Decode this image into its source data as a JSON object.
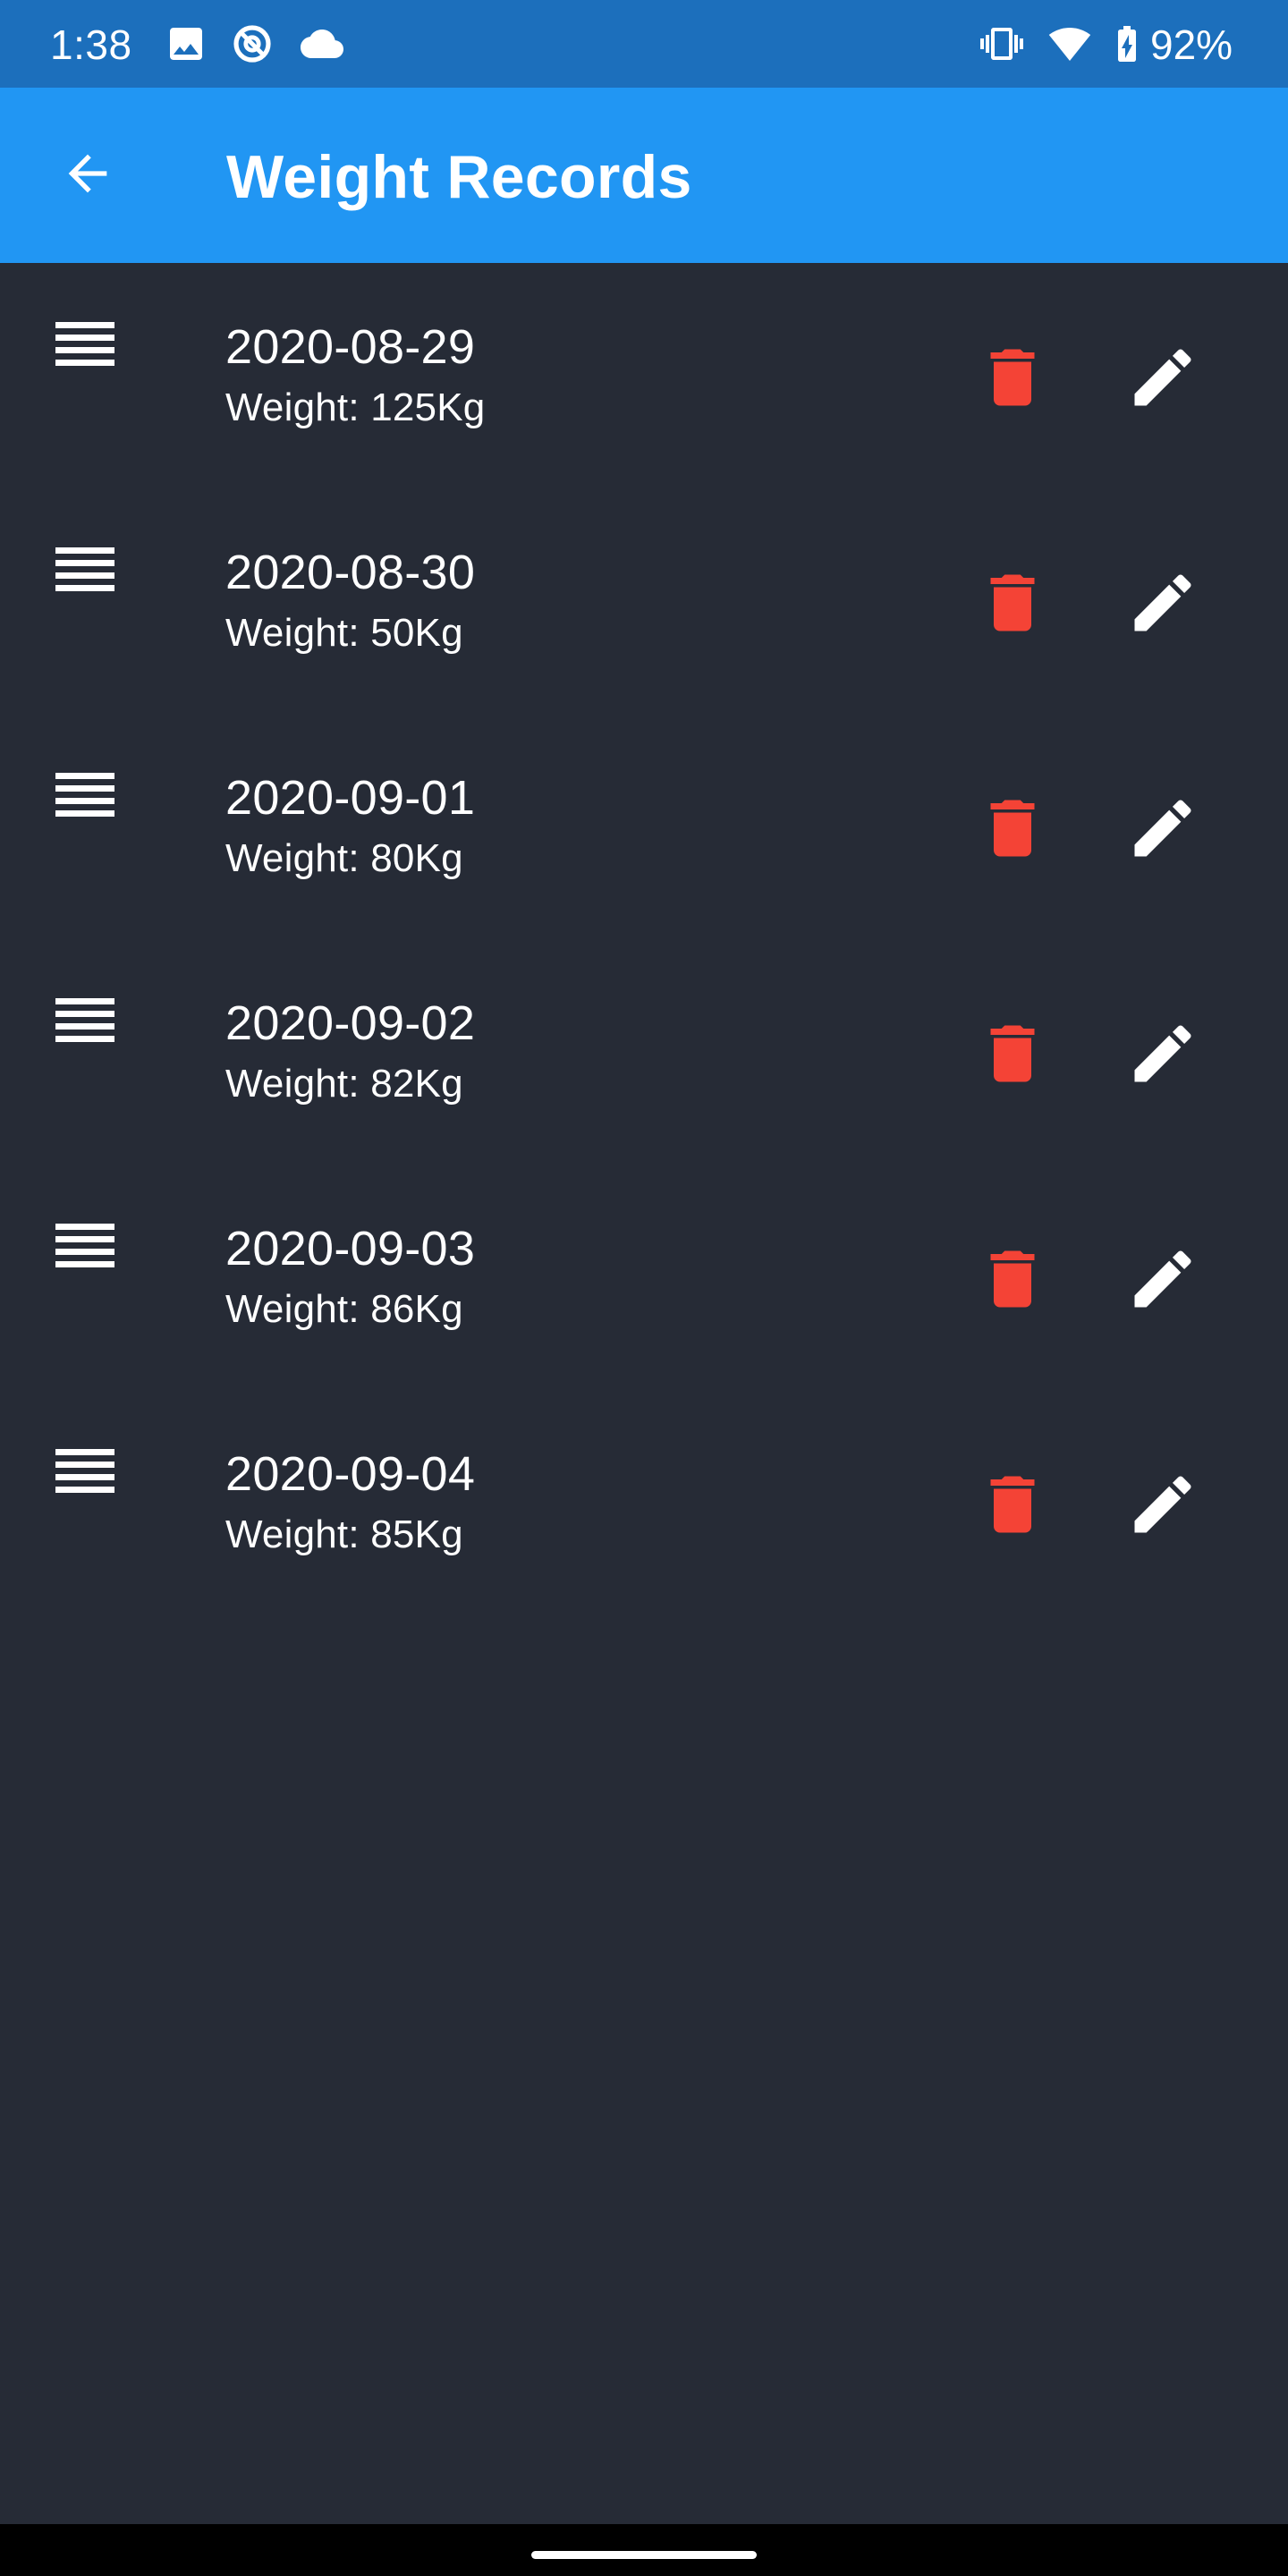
{
  "status_bar": {
    "time": "1:38",
    "battery_percent": "92%",
    "icons": [
      "image-icon",
      "sync-icon",
      "cloud-icon",
      "vibrate-icon",
      "wifi-icon",
      "battery-charging-icon"
    ]
  },
  "app_bar": {
    "title": "Weight Records",
    "back_icon": "arrow-back-icon"
  },
  "records": [
    {
      "date": "2020-08-29",
      "weight": "Weight: 125Kg"
    },
    {
      "date": "2020-08-30",
      "weight": "Weight: 50Kg"
    },
    {
      "date": "2020-09-01",
      "weight": "Weight: 80Kg"
    },
    {
      "date": "2020-09-02",
      "weight": "Weight: 82Kg"
    },
    {
      "date": "2020-09-03",
      "weight": "Weight: 86Kg"
    },
    {
      "date": "2020-09-04",
      "weight": "Weight: 85Kg"
    }
  ],
  "colors": {
    "status_bar": "#1c6fbc",
    "app_bar": "#2196f3",
    "background": "#262b36",
    "delete": "#f44336",
    "text": "#ffffff"
  }
}
